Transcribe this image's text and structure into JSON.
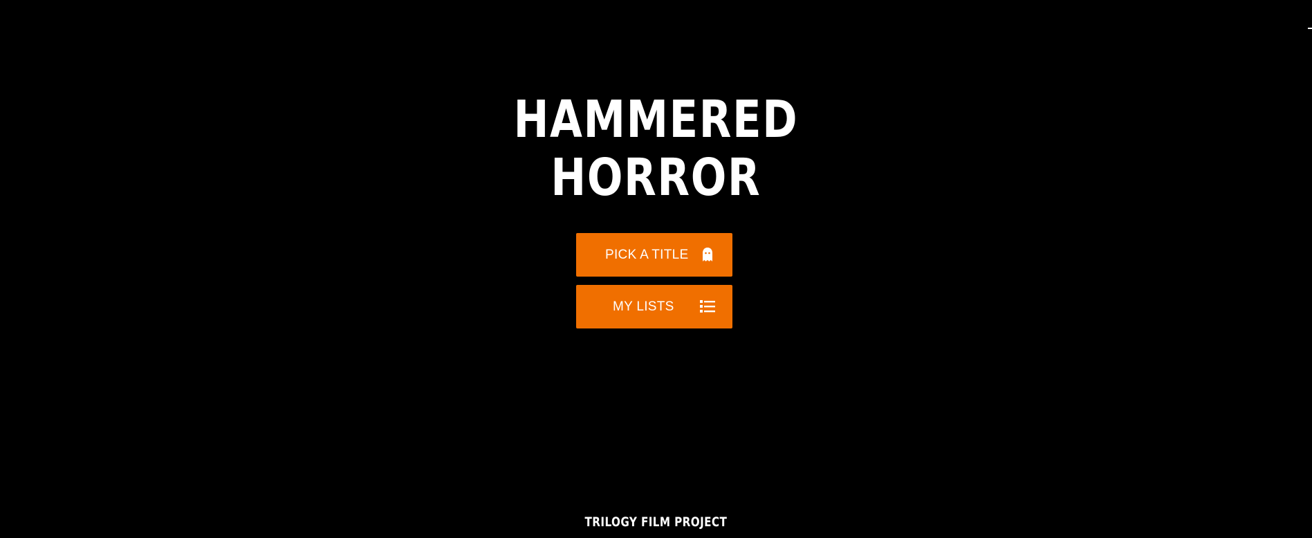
{
  "page": {
    "background": "#000000",
    "accent": "#f06f00",
    "text_color": "#ffffff"
  },
  "header": {
    "title_line_1": "HAMMERED",
    "title_line_2": "HORROR"
  },
  "actions": {
    "pick_title_label": "PICK A TITLE",
    "pick_title_icon": "ghost-icon",
    "my_lists_label": "MY LISTS",
    "my_lists_icon": "list-icon"
  },
  "footer": {
    "label": "TRILOGY FILM PROJECT"
  }
}
